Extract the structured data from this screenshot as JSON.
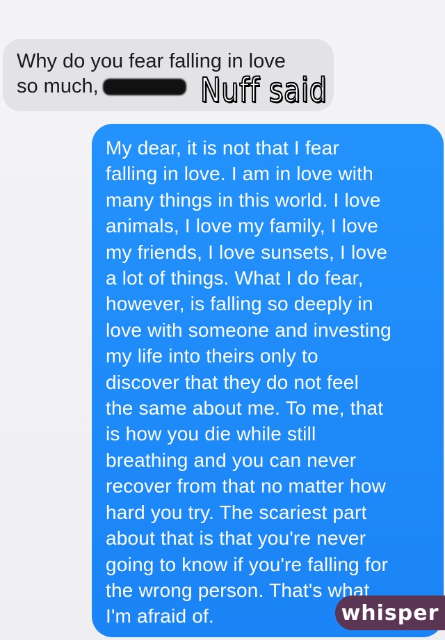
{
  "incoming_message": {
    "lines": [
      "Why do you fear falling in love",
      "so much,"
    ]
  },
  "overlay_text": "Nuff said",
  "outgoing_message": {
    "lines": [
      "My dear, it is not that I fear",
      "falling in love. I am in love with",
      "many things in this world. I love",
      "animals, I love my family, I love",
      "my friends, I love sunsets, I love",
      "a lot of things. What I do fear,",
      "however, is falling so deeply in",
      "love with someone and investing",
      "my life into theirs only to",
      "discover that they do not feel",
      "the same about me. To me, that",
      "is how you die while still",
      "breathing and you can never",
      "recover from that no matter how",
      "hard you try. The scariest part",
      "about that is that you're never",
      "going to know if you're falling for",
      "the wrong person. That's what",
      "I'm afraid of."
    ]
  },
  "watermark": "whisper",
  "colors": {
    "incoming_bubble": "#e3e3e7",
    "outgoing_bubble": "#1b84f6",
    "watermark_badge": "#5a3554"
  }
}
